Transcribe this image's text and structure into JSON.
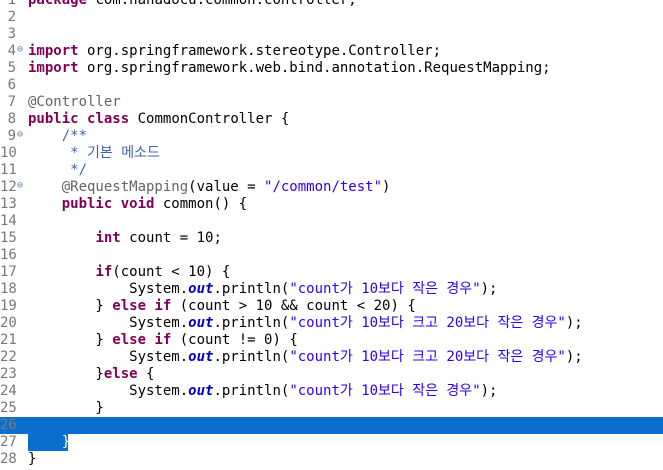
{
  "colors": {
    "keyword": "#7f0055",
    "string": "#2a00ff",
    "annotation": "#646464",
    "javadoc": "#3f5fbf",
    "field": "#0000c0",
    "selection": "#0a6ecf",
    "line_number": "#787878"
  },
  "editor": {
    "file_language": "java",
    "current_line": 26,
    "fold_markers": [
      4,
      9,
      12
    ],
    "lines": [
      {
        "n": "1",
        "tokens": [
          {
            "t": "package",
            "k": "kw"
          },
          {
            "t": " com.hanadocu.common.controller;"
          }
        ]
      },
      {
        "n": "2",
        "tokens": []
      },
      {
        "n": "3",
        "tokens": []
      },
      {
        "n": "4",
        "tokens": [
          {
            "t": "import",
            "k": "kw"
          },
          {
            "t": " org.springframework.stereotype.Controller;"
          }
        ]
      },
      {
        "n": "5",
        "tokens": [
          {
            "t": "import",
            "k": "kw"
          },
          {
            "t": " org.springframework.web.bind.annotation.RequestMapping;"
          }
        ]
      },
      {
        "n": "6",
        "tokens": []
      },
      {
        "n": "7",
        "tokens": [
          {
            "t": "@Controller",
            "k": "ann"
          }
        ]
      },
      {
        "n": "8",
        "tokens": [
          {
            "t": "public",
            "k": "kw"
          },
          {
            "t": " "
          },
          {
            "t": "class",
            "k": "kw"
          },
          {
            "t": " CommonController {"
          }
        ]
      },
      {
        "n": "9",
        "tokens": [
          {
            "t": "    "
          },
          {
            "t": "/**",
            "k": "doc"
          }
        ]
      },
      {
        "n": "10",
        "tokens": [
          {
            "t": "     * 기본 메소드",
            "k": "doc"
          }
        ]
      },
      {
        "n": "11",
        "tokens": [
          {
            "t": "     */",
            "k": "doc"
          }
        ]
      },
      {
        "n": "12",
        "tokens": [
          {
            "t": "    "
          },
          {
            "t": "@RequestMapping",
            "k": "ann"
          },
          {
            "t": "(value = "
          },
          {
            "t": "\"/common/test\"",
            "k": "str"
          },
          {
            "t": ")"
          }
        ]
      },
      {
        "n": "13",
        "tokens": [
          {
            "t": "    "
          },
          {
            "t": "public",
            "k": "kw"
          },
          {
            "t": " "
          },
          {
            "t": "void",
            "k": "kw"
          },
          {
            "t": " common() {"
          }
        ]
      },
      {
        "n": "14",
        "tokens": []
      },
      {
        "n": "15",
        "tokens": [
          {
            "t": "        "
          },
          {
            "t": "int",
            "k": "kw"
          },
          {
            "t": " count = 10;"
          }
        ]
      },
      {
        "n": "16",
        "tokens": []
      },
      {
        "n": "17",
        "tokens": [
          {
            "t": "        "
          },
          {
            "t": "if",
            "k": "kw"
          },
          {
            "t": "(count < 10) {"
          }
        ]
      },
      {
        "n": "18",
        "tokens": [
          {
            "t": "            System."
          },
          {
            "t": "out",
            "k": "fld"
          },
          {
            "t": ".println("
          },
          {
            "t": "\"count가 10보다 작은 경우\"",
            "k": "str"
          },
          {
            "t": ");"
          }
        ]
      },
      {
        "n": "19",
        "tokens": [
          {
            "t": "        } "
          },
          {
            "t": "else",
            "k": "kw"
          },
          {
            "t": " "
          },
          {
            "t": "if",
            "k": "kw"
          },
          {
            "t": " (count > 10 && count < 20) {"
          }
        ]
      },
      {
        "n": "20",
        "tokens": [
          {
            "t": "            System."
          },
          {
            "t": "out",
            "k": "fld"
          },
          {
            "t": ".println("
          },
          {
            "t": "\"count가 10보다 크고 20보다 작은 경우\"",
            "k": "str"
          },
          {
            "t": ");"
          }
        ]
      },
      {
        "n": "21",
        "tokens": [
          {
            "t": "        } "
          },
          {
            "t": "else",
            "k": "kw"
          },
          {
            "t": " "
          },
          {
            "t": "if",
            "k": "kw"
          },
          {
            "t": " (count != 0) {"
          }
        ]
      },
      {
        "n": "22",
        "tokens": [
          {
            "t": "            System."
          },
          {
            "t": "out",
            "k": "fld"
          },
          {
            "t": ".println("
          },
          {
            "t": "\"count가 10보다 크고 20보다 작은 경우\"",
            "k": "str"
          },
          {
            "t": ");"
          }
        ]
      },
      {
        "n": "23",
        "tokens": [
          {
            "t": "        }"
          },
          {
            "t": "else",
            "k": "kw"
          },
          {
            "t": " {"
          }
        ]
      },
      {
        "n": "24",
        "tokens": [
          {
            "t": "            System."
          },
          {
            "t": "out",
            "k": "fld"
          },
          {
            "t": ".println("
          },
          {
            "t": "\"count가 10보다 작은 경우\"",
            "k": "str"
          },
          {
            "t": ");"
          }
        ]
      },
      {
        "n": "25",
        "tokens": [
          {
            "t": "        }"
          }
        ]
      },
      {
        "n": "26",
        "tokens": []
      },
      {
        "n": "27",
        "tokens": [
          {
            "t": "    }",
            "k": "selbrace"
          }
        ]
      },
      {
        "n": "28",
        "tokens": [
          {
            "t": "}"
          }
        ]
      }
    ]
  }
}
